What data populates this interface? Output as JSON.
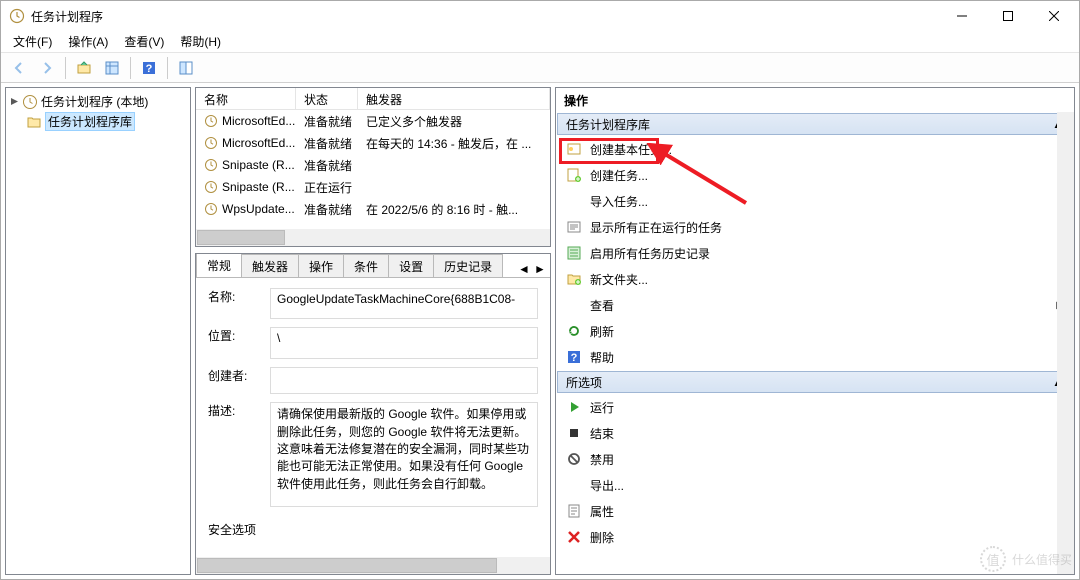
{
  "window": {
    "title": "任务计划程序"
  },
  "window_controls": {
    "minimize": "minimize",
    "maximize": "maximize",
    "close": "close"
  },
  "menubar": [
    {
      "id": "file",
      "label": "文件(F)"
    },
    {
      "id": "action",
      "label": "操作(A)"
    },
    {
      "id": "view",
      "label": "查看(V)"
    },
    {
      "id": "help",
      "label": "帮助(H)"
    }
  ],
  "toolbar": [
    {
      "id": "back",
      "icon": "arrow-left",
      "disabled": true
    },
    {
      "id": "forward",
      "icon": "arrow-right",
      "disabled": true
    },
    {
      "id": "sep1",
      "separator": true
    },
    {
      "id": "up",
      "icon": "folder-up"
    },
    {
      "id": "details",
      "icon": "details"
    },
    {
      "id": "sep2",
      "separator": true
    },
    {
      "id": "help",
      "icon": "help"
    },
    {
      "id": "sep3",
      "separator": true
    },
    {
      "id": "pane-toggle",
      "icon": "pane"
    }
  ],
  "tree": {
    "root": {
      "label": "任务计划程序 (本地)"
    },
    "child": {
      "label": "任务计划程序库"
    }
  },
  "task_list": {
    "columns": {
      "name": "名称",
      "status": "状态",
      "trigger": "触发器"
    },
    "rows": [
      {
        "icon": "clock",
        "name": "MicrosoftEd...",
        "status": "准备就绪",
        "trigger": "已定义多个触发器"
      },
      {
        "icon": "clock",
        "name": "MicrosoftEd...",
        "status": "准备就绪",
        "trigger": "在每天的 14:36 - 触发后，在 ..."
      },
      {
        "icon": "clock",
        "name": "Snipaste (R...",
        "status": "准备就绪",
        "trigger": ""
      },
      {
        "icon": "clock",
        "name": "Snipaste (R...",
        "status": "正在运行",
        "trigger": ""
      },
      {
        "icon": "clock",
        "name": "WpsUpdate...",
        "status": "准备就绪",
        "trigger": "在 2022/5/6 的 8:16 时 - 触..."
      }
    ]
  },
  "detail_tabs": [
    {
      "id": "general",
      "label": "常规",
      "active": true
    },
    {
      "id": "triggers",
      "label": "触发器"
    },
    {
      "id": "actions",
      "label": "操作"
    },
    {
      "id": "conditions",
      "label": "条件"
    },
    {
      "id": "settings",
      "label": "设置"
    },
    {
      "id": "history",
      "label": "历史记录"
    }
  ],
  "detail": {
    "name_label": "名称:",
    "name_value": "GoogleUpdateTaskMachineCore{688B1C08-",
    "location_label": "位置:",
    "location_value": "\\",
    "author_label": "创建者:",
    "author_value": "",
    "desc_label": "描述:",
    "desc_value": "请确保使用最新版的 Google 软件。如果停用或删除此任务，则您的 Google 软件将无法更新。这意味着无法修复潜在的安全漏洞，同时某些功能也可能无法正常使用。如果没有任何 Google 软件使用此任务，则此任务会自行卸载。",
    "security_header": "安全选项"
  },
  "actions_pane": {
    "title": "操作",
    "section1": {
      "label": "任务计划程序库"
    },
    "items1": [
      {
        "id": "create-basic",
        "icon": "wizard",
        "label": "创建基本任务..."
      },
      {
        "id": "create-task",
        "icon": "new-task",
        "label": "创建任务...",
        "highlighted": true
      },
      {
        "id": "import",
        "icon": "blank",
        "label": "导入任务..."
      },
      {
        "id": "show-running",
        "icon": "show-running",
        "label": "显示所有正在运行的任务"
      },
      {
        "id": "enable-history",
        "icon": "history",
        "label": "启用所有任务历史记录"
      },
      {
        "id": "new-folder",
        "icon": "folder-new",
        "label": "新文件夹..."
      },
      {
        "id": "view",
        "icon": "blank",
        "label": "查看",
        "submenu": true
      },
      {
        "id": "refresh",
        "icon": "refresh",
        "label": "刷新"
      },
      {
        "id": "help",
        "icon": "help",
        "label": "帮助"
      }
    ],
    "section2": {
      "label": "所选项"
    },
    "items2": [
      {
        "id": "run",
        "icon": "play",
        "label": "运行"
      },
      {
        "id": "end",
        "icon": "stop",
        "label": "结束"
      },
      {
        "id": "disable",
        "icon": "disable",
        "label": "禁用"
      },
      {
        "id": "export",
        "icon": "blank",
        "label": "导出..."
      },
      {
        "id": "properties",
        "icon": "props",
        "label": "属性"
      },
      {
        "id": "delete",
        "icon": "delete",
        "label": "删除"
      }
    ]
  },
  "watermark": {
    "text": "什么值得买",
    "icon_text": "值"
  }
}
